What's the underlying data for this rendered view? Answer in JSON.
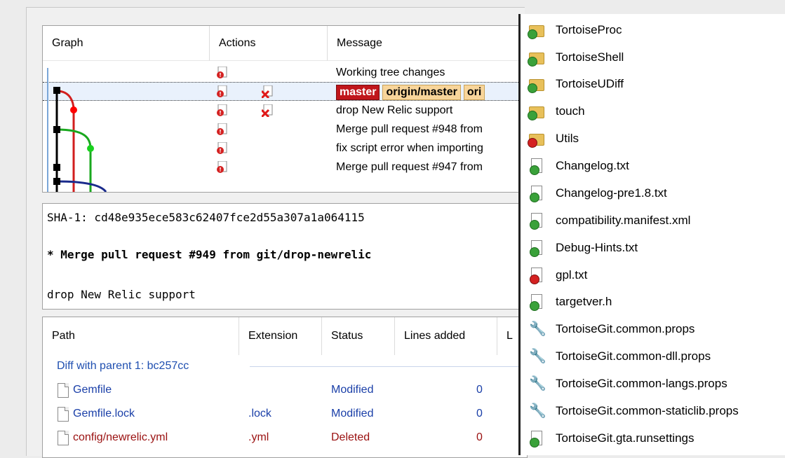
{
  "log": {
    "columns": [
      "Graph",
      "Actions",
      "Message"
    ],
    "rows": [
      {
        "message": "Working tree changes"
      },
      {
        "badges": [
          "master",
          "origin/master",
          "ori"
        ]
      },
      {
        "message": "drop New Relic support"
      },
      {
        "message": "Merge pull request #948 from"
      },
      {
        "message": "fix script error when importing"
      },
      {
        "message": "Merge pull request #947 from"
      }
    ]
  },
  "detail": {
    "sha": "SHA-1: cd48e935ece583c62407fce2d55a307a1a064115",
    "subject": "* Merge pull request #949 from git/drop-newrelic",
    "body": "drop New Relic support"
  },
  "files": {
    "columns": [
      "Path",
      "Extension",
      "Status",
      "Lines added",
      "L"
    ],
    "group": "Diff with parent 1: bc257cc",
    "rows": [
      {
        "path": "Gemfile",
        "ext": "",
        "status": "Modified",
        "added": "0"
      },
      {
        "path": "Gemfile.lock",
        "ext": ".lock",
        "status": "Modified",
        "added": "0"
      },
      {
        "path": "config/newrelic.yml",
        "ext": ".yml",
        "status": "Deleted",
        "added": "0"
      }
    ],
    "colors": {
      "modified": "#1a3fa8",
      "deleted": "#9a1010"
    }
  },
  "explorer": {
    "items": [
      {
        "name": "TortoiseProc",
        "icon": "folder-ok-icon"
      },
      {
        "name": "TortoiseShell",
        "icon": "folder-ok-icon"
      },
      {
        "name": "TortoiseUDiff",
        "icon": "folder-ok-icon"
      },
      {
        "name": "touch",
        "icon": "folder-ok-icon"
      },
      {
        "name": "Utils",
        "icon": "folder-modified-icon"
      },
      {
        "name": "Changelog.txt",
        "icon": "file-ok-icon"
      },
      {
        "name": "Changelog-pre1.8.txt",
        "icon": "file-ok-icon"
      },
      {
        "name": "compatibility.manifest.xml",
        "icon": "file-ok-icon"
      },
      {
        "name": "Debug-Hints.txt",
        "icon": "file-ok-icon"
      },
      {
        "name": "gpl.txt",
        "icon": "file-modified-icon"
      },
      {
        "name": "targetver.h",
        "icon": "file-ok-icon"
      },
      {
        "name": "TortoiseGit.common.props",
        "icon": "wrench-icon"
      },
      {
        "name": "TortoiseGit.common-dll.props",
        "icon": "wrench-icon"
      },
      {
        "name": "TortoiseGit.common-langs.props",
        "icon": "wrench-icon"
      },
      {
        "name": "TortoiseGit.common-staticlib.props",
        "icon": "wrench-icon"
      },
      {
        "name": "TortoiseGit.gta.runsettings",
        "icon": "file-ok-icon"
      }
    ]
  }
}
